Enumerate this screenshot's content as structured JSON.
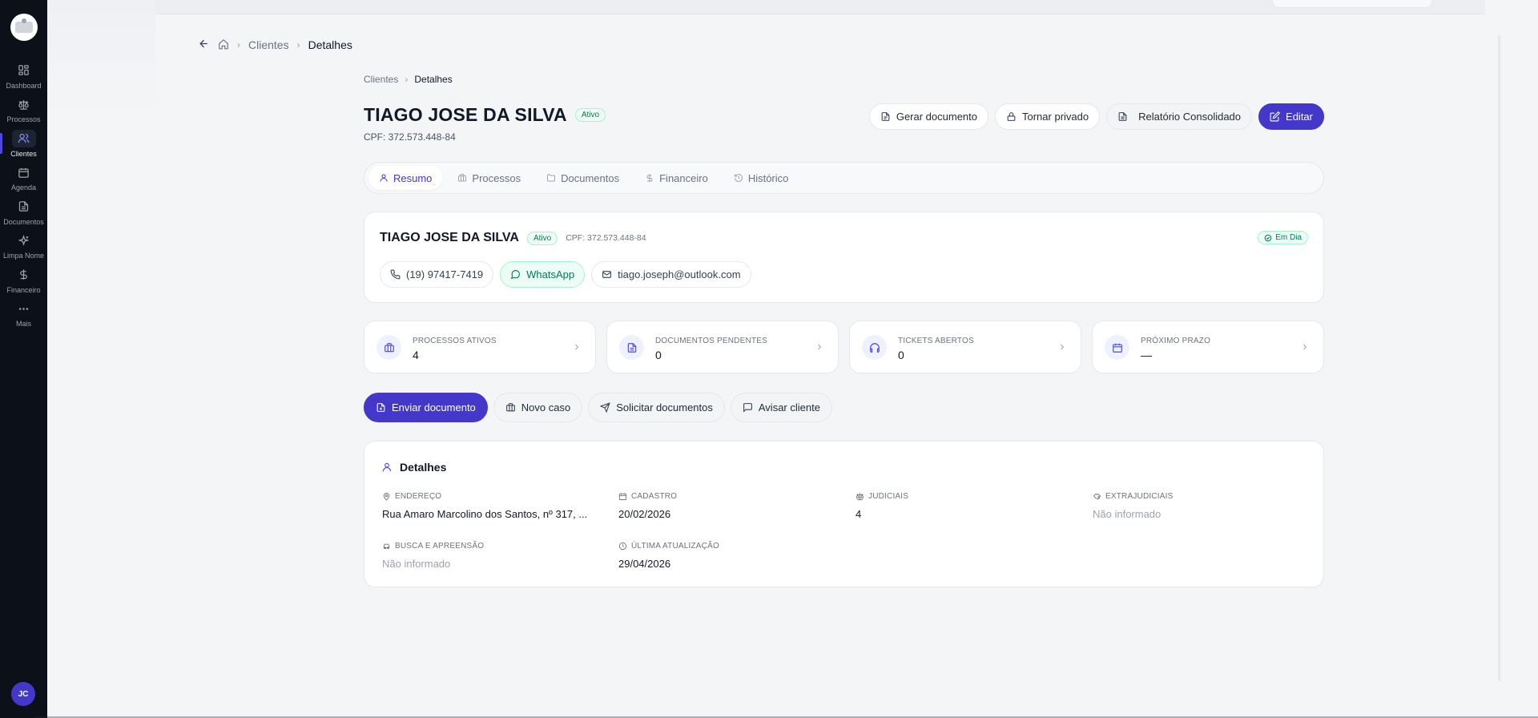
{
  "sidebar": {
    "items": [
      {
        "label": "Dashboard",
        "icon": "dashboard-icon"
      },
      {
        "label": "Processos",
        "icon": "scale-icon"
      },
      {
        "label": "Clientes",
        "icon": "users-icon"
      },
      {
        "label": "Agenda",
        "icon": "calendar-icon"
      },
      {
        "label": "Documentos",
        "icon": "document-icon"
      },
      {
        "label": "Limpa Nome",
        "icon": "sparkle-icon"
      },
      {
        "label": "Financeiro",
        "icon": "dollar-icon"
      },
      {
        "label": "Mais",
        "icon": "more-icon"
      }
    ],
    "active": "Clientes",
    "avatar": "JC"
  },
  "top_breadcrumb": {
    "section": "Clientes",
    "current": "Detalhes"
  },
  "breadcrumb": {
    "section": "Clientes",
    "current": "Detalhes"
  },
  "client": {
    "name": "TIAGO JOSE DA SILVA",
    "status": "Ativo",
    "cpf_line": "CPF: 372.573.448-84",
    "payment_status": "Em Dia",
    "phone": "(19) 97417-7419",
    "whatsapp": "WhatsApp",
    "email": "tiago.joseph@outlook.com"
  },
  "actions": {
    "generate": "Gerar documento",
    "private": "Tornar privado",
    "report": "Relatório Consolidado",
    "edit": "Editar"
  },
  "tabs": [
    "Resumo",
    "Processos",
    "Documentos",
    "Financeiro",
    "Histórico"
  ],
  "stats": [
    {
      "label": "PROCESSOS ATIVOS",
      "value": "4"
    },
    {
      "label": "DOCUMENTOS PENDENTES",
      "value": "0"
    },
    {
      "label": "TICKETS ABERTOS",
      "value": "0"
    },
    {
      "label": "PRÓXIMO PRAZO",
      "value": "—"
    }
  ],
  "quick_actions": {
    "send": "Enviar documento",
    "new_case": "Novo caso",
    "request": "Solicitar documentos",
    "notify": "Avisar cliente"
  },
  "details": {
    "title": "Detalhes",
    "fields": [
      {
        "label": "ENDEREÇO",
        "value": "Rua Amaro Marcolino dos Santos, nº 317, ..."
      },
      {
        "label": "CADASTRO",
        "value": "20/02/2026"
      },
      {
        "label": "JUDICIAIS",
        "value": "4"
      },
      {
        "label": "EXTRAJUDICIAIS",
        "value": "Não informado"
      },
      {
        "label": "BUSCA E APREENSÃO",
        "value": "Não informado"
      },
      {
        "label": "ÚLTIMA ATUALIZAÇÃO",
        "value": "29/04/2026"
      }
    ]
  },
  "colors": {
    "accent": "#4338ca",
    "sidebar": "#0c1018",
    "success": "#047857"
  }
}
